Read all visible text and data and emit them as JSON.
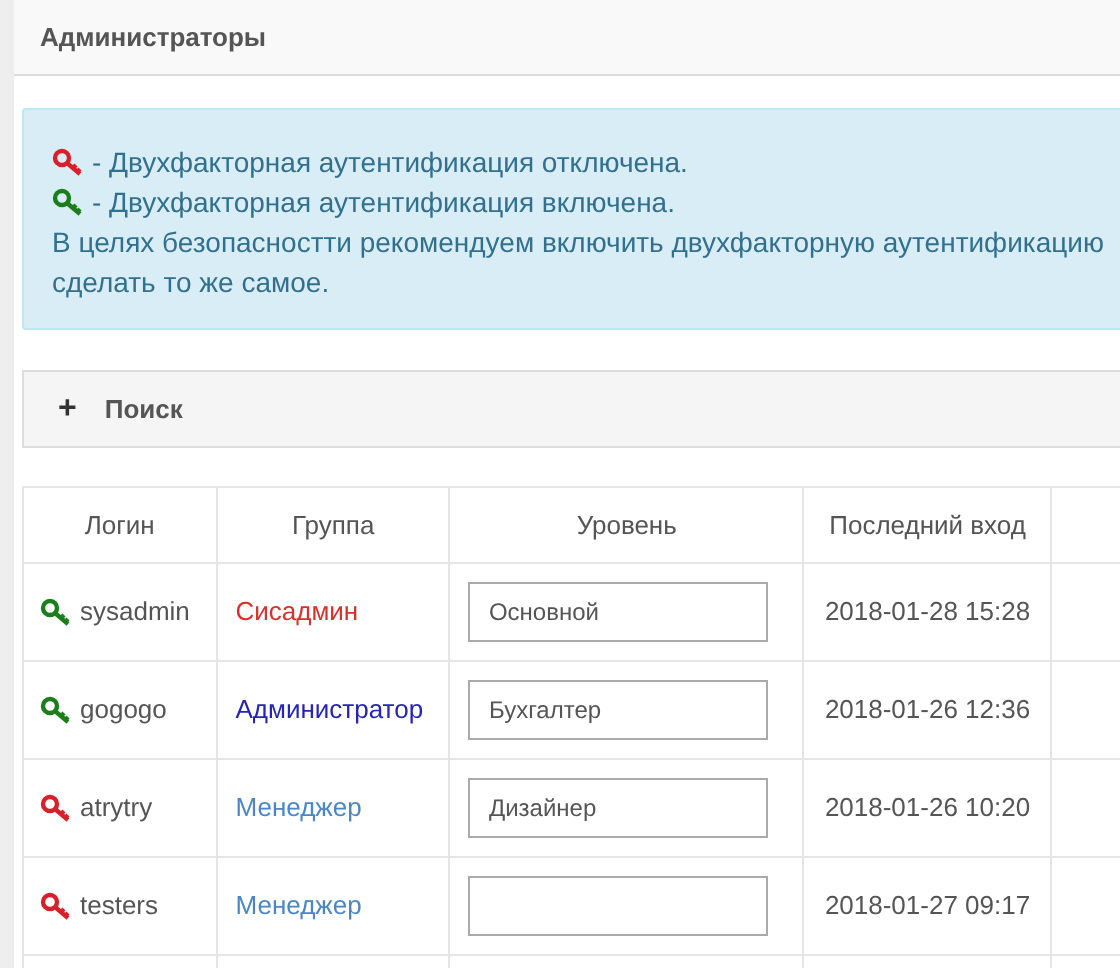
{
  "panel": {
    "title": "Администраторы"
  },
  "legend": [
    {
      "two_factor": false,
      "text": "- Двухфакторная аутентификация отключена."
    },
    {
      "two_factor": true,
      "text": "- Двухфакторная аутентификация включена."
    }
  ],
  "notice_lines": [
    "В целях безопасностти рекомендуем включить двухфакторную аутентификацию",
    "сделать то же самое."
  ],
  "search": {
    "icon": "+",
    "label": "Поиск"
  },
  "table": {
    "columns": [
      "Логин",
      "Группа",
      "Уровень",
      "Последний вход"
    ],
    "rows": [
      {
        "two_factor": true,
        "login": "sysadmin",
        "group": "Сисадмин",
        "color": "#d9302c",
        "level_value": "Основной",
        "last_login": "2018-01-28 15:28"
      },
      {
        "two_factor": true,
        "login": "gogogo",
        "group": "Администратор",
        "color": "#2424b8",
        "level_value": "Бухгалтер",
        "last_login": "2018-01-26 12:36"
      },
      {
        "two_factor": false,
        "login": "atrytry",
        "group": "Менеджер",
        "color": "#4a86c8",
        "level_value": "Дизайнер",
        "last_login": "2018-01-26 10:20"
      },
      {
        "two_factor": false,
        "login": "testers",
        "group": "Менеджер",
        "color": "#4a86c8",
        "last_login": "2018-01-27 09:17"
      }
    ]
  }
}
